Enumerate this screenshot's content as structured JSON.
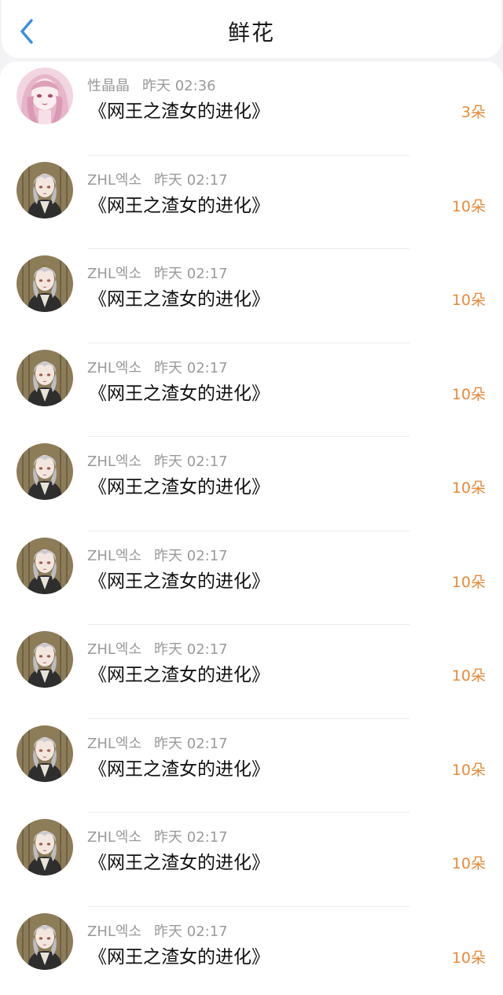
{
  "header": {
    "title": "鲜花",
    "back_icon": "chevron-left-icon",
    "accent_color": "#3a8ee6"
  },
  "count_color": "#e8893a",
  "rows": [
    {
      "user": "性晶晶",
      "time": "昨天 02:36",
      "book": "《网王之渣女的进化》",
      "count": "3朵",
      "avatar": "pink-hair-girl-avatar"
    },
    {
      "user": "ZHL엑소",
      "time": "昨天 02:17",
      "book": "《网王之渣女的进化》",
      "count": "10朵",
      "avatar": "silver-hair-boy-avatar"
    },
    {
      "user": "ZHL엑소",
      "time": "昨天 02:17",
      "book": "《网王之渣女的进化》",
      "count": "10朵",
      "avatar": "silver-hair-boy-avatar"
    },
    {
      "user": "ZHL엑소",
      "time": "昨天 02:17",
      "book": "《网王之渣女的进化》",
      "count": "10朵",
      "avatar": "silver-hair-boy-avatar"
    },
    {
      "user": "ZHL엑소",
      "time": "昨天 02:17",
      "book": "《网王之渣女的进化》",
      "count": "10朵",
      "avatar": "silver-hair-boy-avatar"
    },
    {
      "user": "ZHL엑소",
      "time": "昨天 02:17",
      "book": "《网王之渣女的进化》",
      "count": "10朵",
      "avatar": "silver-hair-boy-avatar"
    },
    {
      "user": "ZHL엑소",
      "time": "昨天 02:17",
      "book": "《网王之渣女的进化》",
      "count": "10朵",
      "avatar": "silver-hair-boy-avatar"
    },
    {
      "user": "ZHL엑소",
      "time": "昨天 02:17",
      "book": "《网王之渣女的进化》",
      "count": "10朵",
      "avatar": "silver-hair-boy-avatar"
    },
    {
      "user": "ZHL엑소",
      "time": "昨天 02:17",
      "book": "《网王之渣女的进化》",
      "count": "10朵",
      "avatar": "silver-hair-boy-avatar"
    },
    {
      "user": "ZHL엑소",
      "time": "昨天 02:17",
      "book": "《网王之渣女的进化》",
      "count": "10朵",
      "avatar": "silver-hair-boy-avatar"
    }
  ]
}
